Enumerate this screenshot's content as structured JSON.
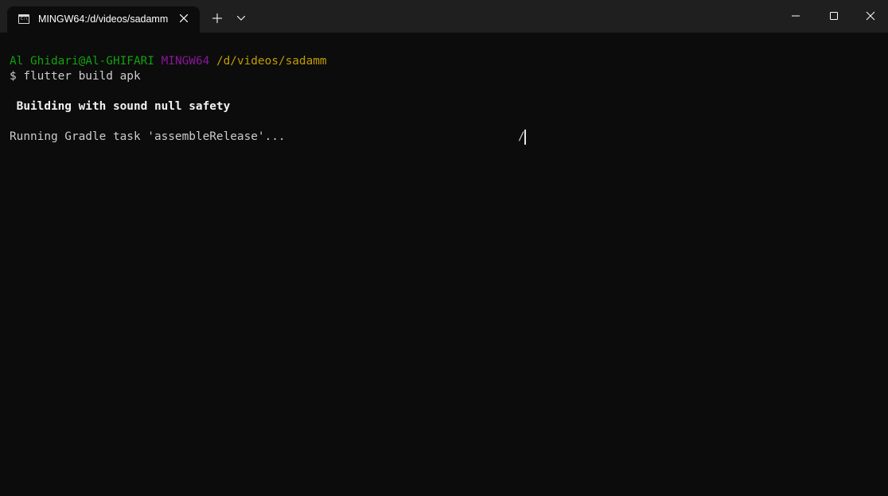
{
  "titlebar": {
    "tab_title": "MINGW64:/d/videos/sadamm",
    "tab_icon": "terminal-icon",
    "tab_close_icon": "close-icon",
    "new_tab_icon": "plus-icon",
    "dropdown_icon": "chevron-down-icon"
  },
  "window_controls": {
    "minimize_icon": "minimize-icon",
    "maximize_icon": "maximize-icon",
    "close_icon": "close-icon"
  },
  "terminal": {
    "prompt": {
      "user_host": "Al Ghidari@Al-GHIFARI",
      "shell": "MINGW64",
      "path": "/d/videos/sadamm"
    },
    "command": "$ flutter build apk",
    "line_building": " Building with sound null safety",
    "line_running": "Running Gradle task 'assembleRelease'...",
    "spinner": "/"
  },
  "colors": {
    "background": "#0c0c0c",
    "titlebar": "#1f1f1f",
    "user_host": "#13a10e",
    "shell": "#881798",
    "path": "#c19c00",
    "text": "#cccccc"
  }
}
